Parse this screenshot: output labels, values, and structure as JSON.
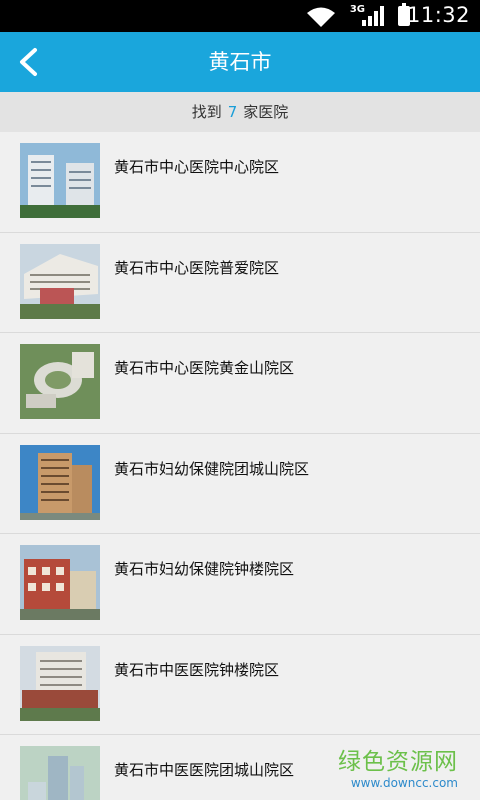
{
  "status_bar": {
    "time": "11:32",
    "network": "3G",
    "icons": [
      "wifi-icon",
      "signal-icon",
      "battery-icon"
    ]
  },
  "header": {
    "title": "黄石市",
    "back_icon": "chevron-left-icon",
    "color": "#1aa6dc"
  },
  "summary": {
    "prefix": "找到",
    "count": "7",
    "suffix": "家医院"
  },
  "hospitals": [
    {
      "name": "黄石市中心医院中心院区"
    },
    {
      "name": "黄石市中心医院普爱院区"
    },
    {
      "name": "黄石市中心医院黄金山院区"
    },
    {
      "name": "黄石市妇幼保健院团城山院区"
    },
    {
      "name": "黄石市妇幼保健院钟楼院区"
    },
    {
      "name": "黄石市中医医院钟楼院区"
    },
    {
      "name": "黄石市中医医院团城山院区"
    }
  ],
  "watermark": {
    "title": "绿色资源网",
    "url": "www.downcc.com"
  }
}
